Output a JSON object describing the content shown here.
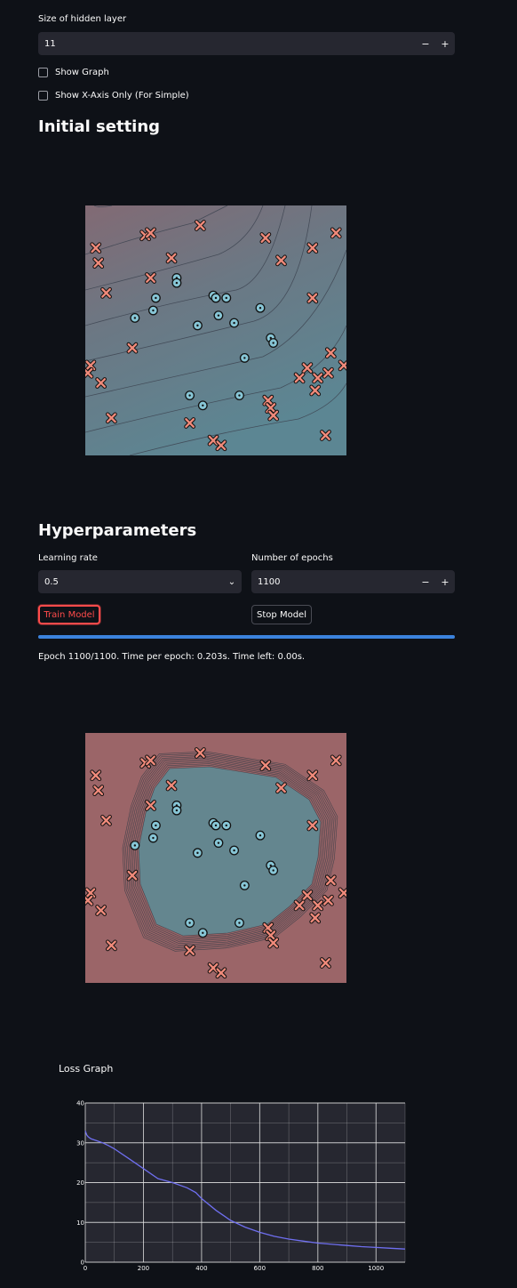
{
  "hidden_layer": {
    "label": "Size of hidden layer",
    "value": "11",
    "minus": "−",
    "plus": "+"
  },
  "checkboxes": [
    {
      "label": "Show Graph",
      "checked": false
    },
    {
      "label": "Show X-Axis Only (For Simple)",
      "checked": false
    }
  ],
  "initial_section": {
    "title": "Initial setting"
  },
  "hyper_section": {
    "title": "Hyperparameters"
  },
  "learning_rate": {
    "label": "Learning rate",
    "value": "0.5",
    "caret": "⌄"
  },
  "epochs": {
    "label": "Number of epochs",
    "value": "1100",
    "minus": "−",
    "plus": "+"
  },
  "buttons": {
    "train": "Train Model",
    "stop": "Stop Model"
  },
  "progress": {
    "fraction": 1.0,
    "color": "#3b82dc"
  },
  "status_text": "Epoch 1100/1100. Time per epoch: 0.203s. Time left: 0.00s.",
  "colors": {
    "positive_marker": "#f08a7a",
    "negative_marker": "#87c6d6",
    "trained_outer": "#9b6568",
    "trained_inner": "#5f8a94",
    "loss_line": "#6f6ff0"
  },
  "scatter_points": {
    "x_class": [
      [
        0.04,
        0.17
      ],
      [
        0.05,
        0.23
      ],
      [
        0.23,
        0.12
      ],
      [
        0.25,
        0.11
      ],
      [
        0.44,
        0.08
      ],
      [
        0.69,
        0.13
      ],
      [
        0.87,
        0.17
      ],
      [
        0.96,
        0.11
      ],
      [
        0.33,
        0.21
      ],
      [
        0.75,
        0.22
      ],
      [
        0.08,
        0.35
      ],
      [
        0.25,
        0.29
      ],
      [
        0.87,
        0.37
      ],
      [
        0.18,
        0.57
      ],
      [
        0.02,
        0.64
      ],
      [
        0.01,
        0.67
      ],
      [
        0.06,
        0.71
      ],
      [
        0.85,
        0.65
      ],
      [
        0.82,
        0.69
      ],
      [
        0.89,
        0.69
      ],
      [
        0.93,
        0.67
      ],
      [
        0.99,
        0.64
      ],
      [
        0.88,
        0.74
      ],
      [
        0.94,
        0.59
      ],
      [
        0.7,
        0.78
      ],
      [
        0.71,
        0.81
      ],
      [
        0.72,
        0.84
      ],
      [
        0.1,
        0.85
      ],
      [
        0.4,
        0.87
      ],
      [
        0.49,
        0.94
      ],
      [
        0.52,
        0.96
      ],
      [
        0.92,
        0.92
      ]
    ],
    "o_class": [
      [
        0.35,
        0.29
      ],
      [
        0.35,
        0.31
      ],
      [
        0.27,
        0.37
      ],
      [
        0.49,
        0.36
      ],
      [
        0.5,
        0.37
      ],
      [
        0.54,
        0.37
      ],
      [
        0.26,
        0.42
      ],
      [
        0.19,
        0.45
      ],
      [
        0.51,
        0.44
      ],
      [
        0.57,
        0.47
      ],
      [
        0.67,
        0.41
      ],
      [
        0.43,
        0.48
      ],
      [
        0.71,
        0.53
      ],
      [
        0.72,
        0.55
      ],
      [
        0.61,
        0.61
      ],
      [
        0.4,
        0.76
      ],
      [
        0.45,
        0.8
      ],
      [
        0.59,
        0.76
      ]
    ]
  },
  "loss_chart": {
    "title": "Loss Graph",
    "chart_data": {
      "type": "line",
      "title": "Loss Graph",
      "x": [
        0,
        5,
        10,
        20,
        40,
        60,
        80,
        100,
        150,
        200,
        250,
        300,
        350,
        380,
        400,
        450,
        500,
        550,
        600,
        650,
        700,
        750,
        800,
        850,
        900,
        950,
        1000,
        1050,
        1100
      ],
      "y": [
        33,
        32,
        31.5,
        31,
        30.5,
        30,
        29.3,
        28.5,
        26,
        23.5,
        21,
        20,
        18.7,
        17.5,
        16,
        13,
        10.5,
        8.8,
        7.5,
        6.5,
        5.8,
        5.3,
        4.8,
        4.5,
        4.2,
        3.9,
        3.7,
        3.5,
        3.3
      ],
      "xlim": [
        0,
        1100
      ],
      "ylim": [
        0,
        40
      ],
      "xticks": [
        "0",
        "200",
        "400",
        "600",
        "800",
        "1000"
      ],
      "yticks": [
        "0",
        "10",
        "20",
        "30",
        "40"
      ],
      "grid": true
    }
  }
}
